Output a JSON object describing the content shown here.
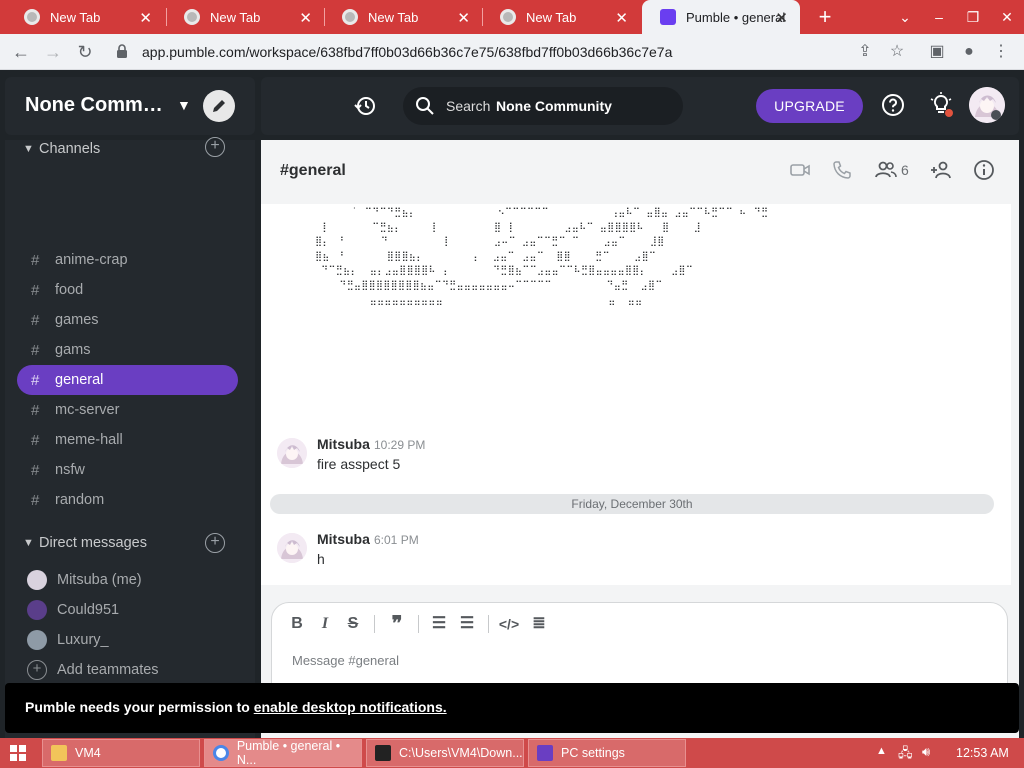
{
  "browser": {
    "tabs": [
      {
        "title": "New Tab",
        "active": false
      },
      {
        "title": "New Tab",
        "active": false
      },
      {
        "title": "New Tab",
        "active": false
      },
      {
        "title": "New Tab",
        "active": false
      },
      {
        "title": "Pumble • general",
        "active": true
      }
    ],
    "url": "app.pumble.com/workspace/638fbd7ff0b03d66b36c7e75/638fbd7ff0b03d66b36c7e7a"
  },
  "workspace": {
    "name": "None Community",
    "search_label": "Search",
    "search_scope": "None Community",
    "upgrade_label": "UPGRADE"
  },
  "sidebar": {
    "channels_heading": "Channels",
    "channels": [
      {
        "name": "anime-crap",
        "active": false
      },
      {
        "name": "food",
        "active": false
      },
      {
        "name": "games",
        "active": false
      },
      {
        "name": "gams",
        "active": false
      },
      {
        "name": "general",
        "active": true
      },
      {
        "name": "mc-server",
        "active": false
      },
      {
        "name": "meme-hall",
        "active": false
      },
      {
        "name": "nsfw",
        "active": false
      },
      {
        "name": "random",
        "active": false
      }
    ],
    "dm_heading": "Direct messages",
    "dms": [
      {
        "name": "Mitsuba (me)",
        "color": "#d9d2de"
      },
      {
        "name": "Could951",
        "color": "#5a3e8a"
      },
      {
        "name": "Luxury_",
        "color": "#8e9aa6"
      }
    ],
    "add_teammates": "Add teammates"
  },
  "channel": {
    "title": "#general",
    "member_count": "6"
  },
  "messages": [
    {
      "author": "Mitsuba",
      "time": "10:29 PM",
      "text": "fire asspect 5"
    },
    {
      "author": "Mitsuba",
      "time": "6:01 PM",
      "text": "h"
    }
  ],
  "date_divider": "Friday, December 30th",
  "ascii_art_lines": [
    "       ˙⠀⠉⠙⠉⠙⣛⣦⡄           ⠀⠀⠢⠉⠉⠉⠉⠉⠉⠀         ⢠⣤⠧⠉ ⣤⣿⣤ ⣠⣤⠉⠉⠧⣛⠉⠉ ⠦⠀⠙⣛",
    " ⠀⡇       ⠉⣛⣦⡄     ⡇         ⣿⠀⡇        ⣠⣤⠧⠉ ⣤⣿⣿⣿⣿⠧   ⣿    ⣸",
    " ⣿⡄⠀⠘      ⠙        ⠀⡇       ⣠⠤⠉ ⣠⣤⠉⠉⣛⠉ ⠉    ⣠⣤⠉    ⣸⣿",
    " ⣿⣦⠀⠘       ⣿⣿⣿⣦⡄       ⠀⡄  ⣠⣤⠉⠀⣠⣤⠉  ⣿⣿    ⣛⠉    ⣠⣿⠉",
    "  ⠙⠉⣛⣦⡄  ⣤⡄⣠⣤⣿⣿⣿⣿⠧⠀⡄       ⠙⣛⣿⣦⠉⠉⣠⣤⣤⠉⠉⠧⣛⣿⣤⣤⣤⣤⣿⣿⡄    ⣠⣿⠉",
    "     ⠙⣛⣤⣿⣿⣿⣿⣿⣿⣿⣿⣦⣤⠉⠙⣛⣤⣤⣤⣤⣤⣤⣤⠤⠉⠉⠉⠉⠉         ⠙⣤⣛  ⣠⣿⠉",
    "          ⣤⣤⣤⣤⣤⣤⣤⣤⣤⣤                         ⠀ ⣤  ⣤⣤⠀"
  ],
  "composer": {
    "placeholder": "Message #general",
    "format_buttons": [
      "bold-icon",
      "italic-icon",
      "strikethrough-icon",
      "quote-icon",
      "numbered-list-icon",
      "bullet-list-icon",
      "code-icon",
      "code-block-icon"
    ],
    "action_buttons": [
      "text-format-icon",
      "mention-icon",
      "emoji-icon",
      "attach-icon",
      "microphone-icon",
      "send-icon"
    ]
  },
  "notification": {
    "text": "Pumble needs your permission to ",
    "link": "enable desktop notifications."
  },
  "taskbar": {
    "items": [
      {
        "label": "VM4",
        "active": false
      },
      {
        "label": "Pumble • general • N...",
        "active": true
      },
      {
        "label": "C:\\Users\\VM4\\Down...",
        "active": false
      },
      {
        "label": "PC settings",
        "active": false
      }
    ],
    "clock": "12:53 AM"
  },
  "colors": {
    "accent": "#6a3ec2",
    "sidebar_bg": "#24292e",
    "chrome_red": "#d23a3a"
  }
}
